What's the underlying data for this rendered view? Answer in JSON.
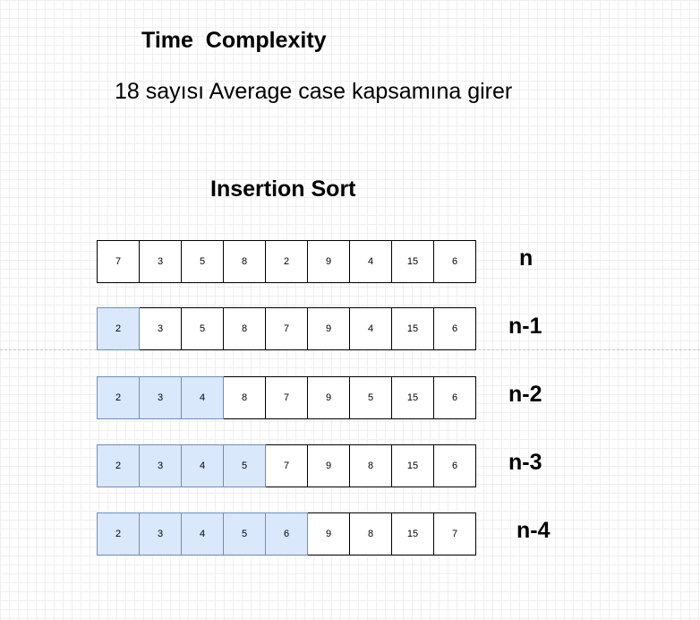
{
  "title": "Time  Complexity",
  "subtitle": "18 sayısı Average case kapsamına girer",
  "section_title": "Insertion Sort",
  "colors": {
    "sorted_fill": "#dae8fc",
    "sorted_border": "#6c8ebf",
    "default_fill": "#ffffff"
  },
  "rows": [
    {
      "label": "n",
      "sorted_count": 0,
      "values": [
        "7",
        "3",
        "5",
        "8",
        "2",
        "9",
        "4",
        "15",
        "6"
      ]
    },
    {
      "label": "n-1",
      "sorted_count": 1,
      "values": [
        "2",
        "3",
        "5",
        "8",
        "7",
        "9",
        "4",
        "15",
        "6"
      ]
    },
    {
      "label": "n-2",
      "sorted_count": 3,
      "values": [
        "2",
        "3",
        "4",
        "8",
        "7",
        "9",
        "5",
        "15",
        "6"
      ]
    },
    {
      "label": "n-3",
      "sorted_count": 4,
      "values": [
        "2",
        "3",
        "4",
        "5",
        "7",
        "9",
        "8",
        "15",
        "6"
      ]
    },
    {
      "label": "n-4",
      "sorted_count": 5,
      "values": [
        "2",
        "3",
        "4",
        "5",
        "6",
        "9",
        "8",
        "15",
        "7"
      ]
    }
  ]
}
